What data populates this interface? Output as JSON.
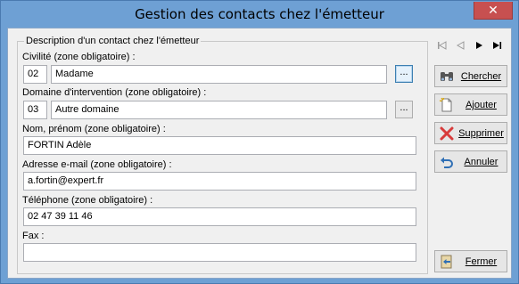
{
  "window": {
    "title": "Gestion des contacts chez l'émetteur",
    "close_glyph": "✕"
  },
  "group": {
    "legend": "Description d'un contact chez l'émetteur"
  },
  "civilite": {
    "label": "Civilité (zone obligatoire) :",
    "code": "02",
    "value": "Madame",
    "button": "..."
  },
  "domaine": {
    "label": "Domaine d'intervention (zone obligatoire) :",
    "code": "03",
    "value": "Autre domaine",
    "button": "..."
  },
  "nom": {
    "label": "Nom, prénom (zone obligatoire) :",
    "value": "FORTIN Adèle"
  },
  "email": {
    "label": "Adresse e-mail (zone obligatoire) :",
    "value": "a.fortin@expert.fr"
  },
  "telephone": {
    "label": "Téléphone (zone obligatoire) :",
    "value": "02 47 39 11 46"
  },
  "fax": {
    "label": "Fax :",
    "value": ""
  },
  "navigation": {
    "first_icon": "first-record-icon",
    "prev_icon": "previous-record-icon",
    "next_icon": "next-record-icon",
    "last_icon": "last-record-icon"
  },
  "actions": {
    "chercher": "Chercher",
    "ajouter": "Ajouter",
    "supprimer": "Supprimer",
    "annuler": "Annuler",
    "fermer": "Fermer"
  },
  "colors": {
    "titlebar": "#6ea0d4",
    "close": "#c75050",
    "delete_red": "#d83b3b",
    "undo_blue": "#2f6fb5"
  }
}
